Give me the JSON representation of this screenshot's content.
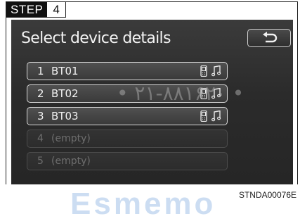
{
  "step": {
    "word": "STEP",
    "number": "4"
  },
  "screen": {
    "title": "Select device details",
    "back_icon": "return-arrow-icon"
  },
  "devices": [
    {
      "index": "1",
      "name": "BT01",
      "enabled": true,
      "icons": [
        "phone-icon",
        "music-note-icon"
      ]
    },
    {
      "index": "2",
      "name": "BT02",
      "enabled": true,
      "icons": [
        "phone-icon",
        "music-note-icon"
      ]
    },
    {
      "index": "3",
      "name": "BT03",
      "enabled": true,
      "icons": [
        "phone-icon",
        "music-note-icon"
      ]
    },
    {
      "index": "4",
      "name": "(empty)",
      "enabled": false
    },
    {
      "index": "5",
      "name": "(empty)",
      "enabled": false
    }
  ],
  "watermark_persian": "• ۲۱-۸۸۱۶۲۰ •",
  "watermark_brand": "Esmemo",
  "figure_code": "STNDA00076E"
}
